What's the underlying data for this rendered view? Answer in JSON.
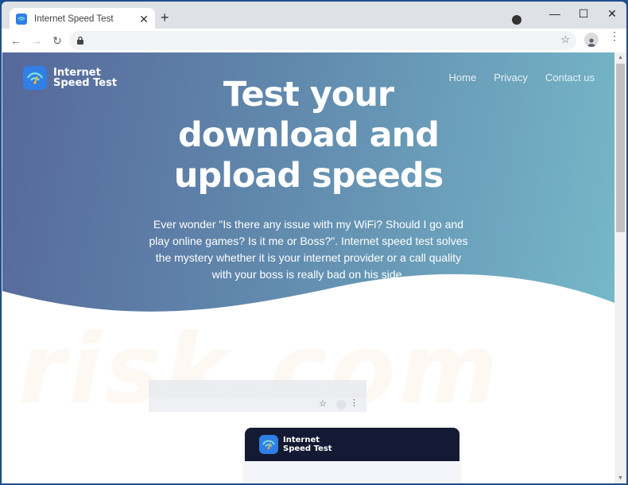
{
  "browser": {
    "tab_title": "Internet Speed Test",
    "tab_close": "✕",
    "new_tab": "+",
    "window_controls": {
      "minimize": "—",
      "maximize": "☐",
      "close": "✕"
    },
    "back": "←",
    "forward": "→",
    "reload": "↻",
    "lock": "🔒",
    "address": "",
    "bookmark_star": "☆",
    "menu": "⋮"
  },
  "site": {
    "logo_line1": "Internet",
    "logo_line2": "Speed Test",
    "nav": [
      {
        "label": "Home"
      },
      {
        "label": "Privacy"
      },
      {
        "label": "Contact us"
      }
    ],
    "hero_title_line1": "Test your",
    "hero_title_line2": "download and",
    "hero_title_line3": "upload speeds",
    "hero_text": "Ever wonder \"Is there any issue with my WiFi? Should I go and play online games? Is it me or Boss?\". Internet speed test solves the mystery whether it is your internet provider or a call quality with your boss is really bad on his side.",
    "watermark": "risk.com",
    "mockup": {
      "star": "☆",
      "menu": "⋮",
      "card_logo_line1": "Internet",
      "card_logo_line2": "Speed Test"
    }
  },
  "colors": {
    "brand_blue": "#2f7fe6",
    "hero_start": "#56689a",
    "hero_end": "#76b8c9",
    "card_header": "#141a33"
  }
}
